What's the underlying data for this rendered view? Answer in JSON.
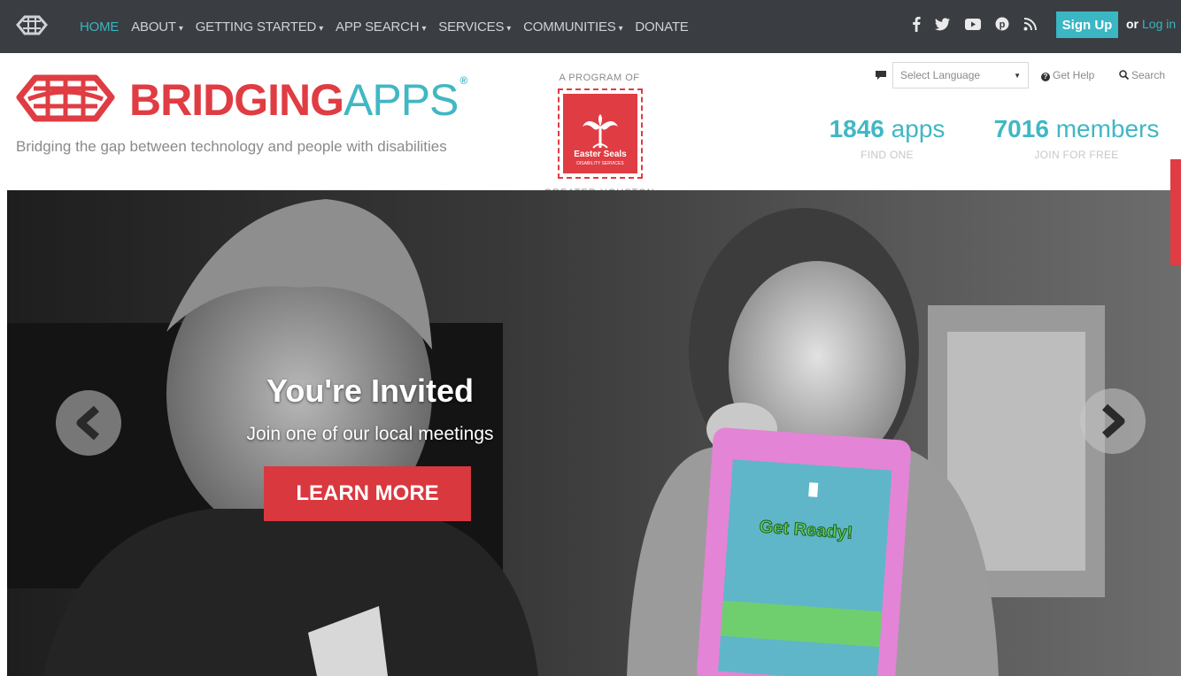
{
  "topnav": {
    "items": [
      {
        "label": "HOME",
        "caret": ""
      },
      {
        "label": "ABOUT",
        "caret": "▾"
      },
      {
        "label": "GETTING STARTED",
        "caret": "▾"
      },
      {
        "label": "APP SEARCH",
        "caret": "▾"
      },
      {
        "label": "SERVICES",
        "caret": "▾"
      },
      {
        "label": "COMMUNITIES",
        "caret": "▾"
      },
      {
        "label": "DONATE",
        "caret": ""
      }
    ],
    "social": {
      "facebook": "f",
      "twitter": "🐦",
      "youtube": "▶",
      "pinterest": "℗",
      "rss": "⟟"
    },
    "signup_label": "Sign Up",
    "or_label": "or",
    "login_label": "Log in"
  },
  "header": {
    "brand_part1": "BRIDGING",
    "brand_part2": "APPS",
    "brand_mark": "®",
    "tagline": "Bridging the gap between technology and people with disabilities",
    "program_label": "A PROGRAM OF",
    "seal_text": "Easter Seals",
    "seal_sub": "DISABILITY SERVICES",
    "greater_houston": "GREATER HOUSTON",
    "language_placeholder": "Select Language",
    "help_label": "Get Help",
    "search_label": "Search",
    "apps_count": "1846",
    "apps_word": "apps",
    "apps_sub": "FIND ONE",
    "members_count": "7016",
    "members_word": "members",
    "members_sub": "JOIN FOR FREE"
  },
  "hero": {
    "title": "You're Invited",
    "subtitle": "Join one of our local meetings",
    "button_label": "LEARN MORE"
  },
  "colors": {
    "brand_red": "#e03c43",
    "brand_teal": "#41b7c4",
    "nav_bg": "#3a3d42"
  }
}
